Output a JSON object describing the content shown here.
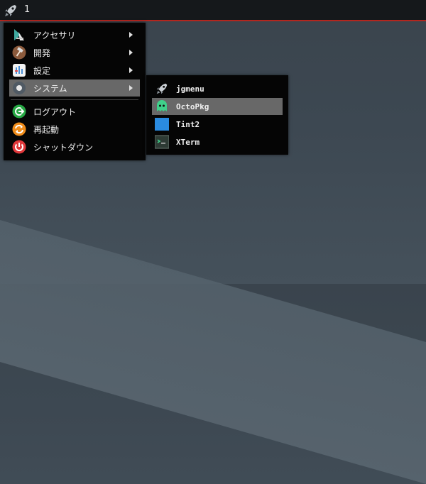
{
  "panel": {
    "launcher_icon": "rocket-icon",
    "workspace": "1",
    "accent_color": "#b3261e"
  },
  "main_menu": {
    "items": [
      {
        "label": "アクセサリ",
        "icon": "accessories-icon",
        "has_submenu": true
      },
      {
        "label": "開発",
        "icon": "hammer-icon",
        "has_submenu": true
      },
      {
        "label": "設定",
        "icon": "settings-icon",
        "has_submenu": true
      },
      {
        "label": "システム",
        "icon": "system-icon",
        "has_submenu": true,
        "active": true
      },
      {
        "label": "ログアウト",
        "icon": "logout-icon",
        "has_submenu": false
      },
      {
        "label": "再起動",
        "icon": "reboot-icon",
        "has_submenu": false
      },
      {
        "label": "シャットダウン",
        "icon": "power-icon",
        "has_submenu": false
      }
    ]
  },
  "sub_menu": {
    "items": [
      {
        "label": "jgmenu",
        "icon": "rocket-icon"
      },
      {
        "label": "OctoPkg",
        "icon": "octopus-icon",
        "active": true
      },
      {
        "label": "Tint2",
        "icon": "panel-icon"
      },
      {
        "label": "XTerm",
        "icon": "terminal-icon"
      }
    ]
  }
}
